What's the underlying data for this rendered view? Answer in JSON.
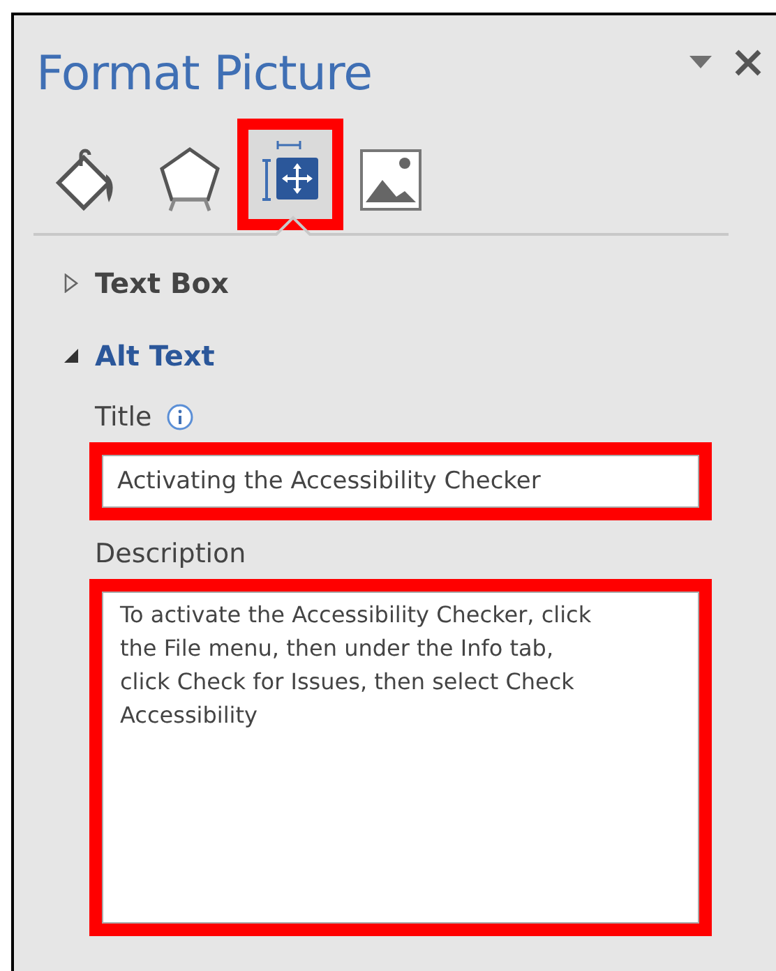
{
  "pane": {
    "title": "Format Picture"
  },
  "tabs": [
    {
      "kind": "fill",
      "selected": false,
      "highlighted": false
    },
    {
      "kind": "effects",
      "selected": false,
      "highlighted": false
    },
    {
      "kind": "layout",
      "selected": true,
      "highlighted": true
    },
    {
      "kind": "picture",
      "selected": false,
      "highlighted": false
    }
  ],
  "sections": [
    {
      "label": "Text Box",
      "expanded": false
    },
    {
      "label": "Alt Text",
      "expanded": true,
      "fields": [
        {
          "kind": "line",
          "label": "Title",
          "info": true,
          "value": "Activating the Accessibility Checker",
          "highlighted": true
        },
        {
          "kind": "area",
          "label": "Description",
          "info": false,
          "value": "To activate the Accessibility Checker, click the File menu, then under the Info tab, click Check for Issues, then select Check Accessibility",
          "highlighted": true
        }
      ]
    }
  ]
}
